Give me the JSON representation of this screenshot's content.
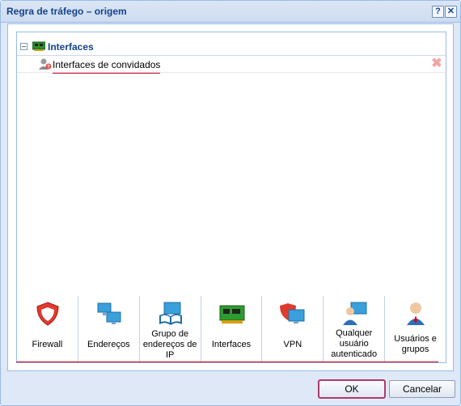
{
  "window": {
    "title": "Regra de tráfego – origem",
    "help_label": "?",
    "close_label": "✕"
  },
  "tree": {
    "collapse_label": "–",
    "group": {
      "label": "Interfaces",
      "icon": "network-card-icon"
    },
    "items": [
      {
        "label": "Interfaces de convidados",
        "icon": "guest-user-icon"
      }
    ]
  },
  "palette": {
    "items": [
      {
        "label": "Firewall",
        "icon": "firewall-shield-icon"
      },
      {
        "label": "Endereços",
        "icon": "addresses-network-icon"
      },
      {
        "label": "Grupo de endereços de IP",
        "icon": "ip-group-book-icon"
      },
      {
        "label": "Interfaces",
        "icon": "network-card-icon"
      },
      {
        "label": "VPN",
        "icon": "vpn-shield-monitor-icon"
      },
      {
        "label": "Qualquer usuário autenticado",
        "icon": "authenticated-user-icon"
      },
      {
        "label": "Usuários e grupos",
        "icon": "users-groups-icon"
      }
    ]
  },
  "buttons": {
    "ok": "OK",
    "cancel": "Cancelar"
  },
  "colors": {
    "title_text": "#15428b",
    "border": "#99bbe8",
    "highlight": "#d0021b"
  }
}
